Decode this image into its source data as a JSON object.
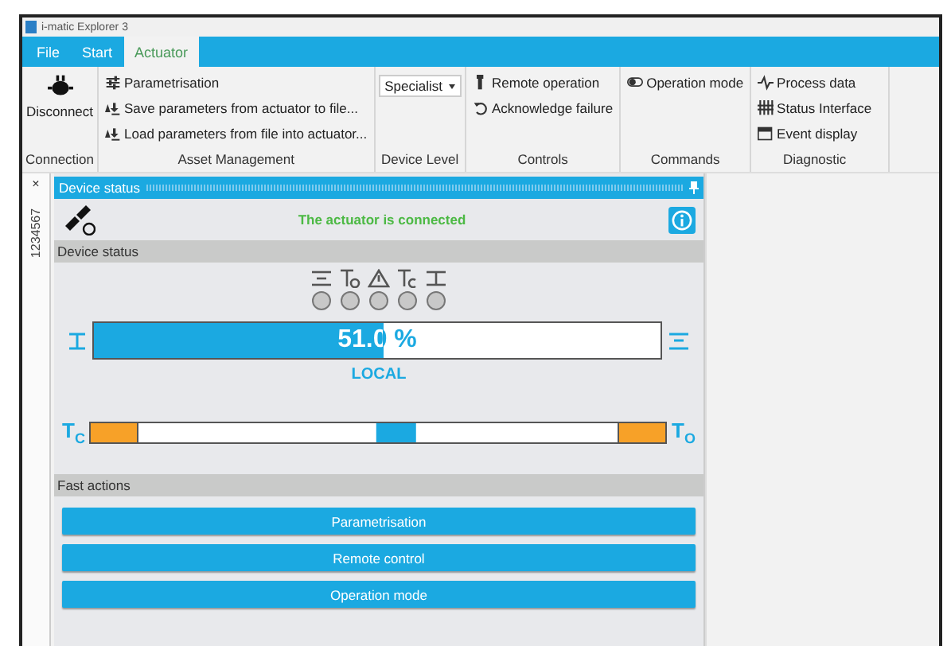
{
  "window": {
    "title": "i-matic Explorer 3"
  },
  "menu_tabs": [
    {
      "label": "File",
      "selected": false
    },
    {
      "label": "Start",
      "selected": false
    },
    {
      "label": "Actuator",
      "selected": true
    }
  ],
  "ribbon": {
    "groups": [
      {
        "title": "Connection",
        "items": [
          {
            "kind": "large",
            "label": "Disconnect"
          }
        ]
      },
      {
        "title": "Asset Management",
        "items": [
          {
            "kind": "small",
            "label": "Parametrisation"
          },
          {
            "kind": "small",
            "label": "Save parameters from actuator to file..."
          },
          {
            "kind": "small",
            "label": "Load parameters from file into actuator..."
          }
        ]
      },
      {
        "title": "Device Level",
        "items": [
          {
            "kind": "dropdown",
            "value": "Specialist"
          }
        ]
      },
      {
        "title": "Controls",
        "items": [
          {
            "kind": "small",
            "label": "Remote operation"
          },
          {
            "kind": "small",
            "label": "Acknowledge failure"
          }
        ]
      },
      {
        "title": "Commands",
        "items": [
          {
            "kind": "small",
            "label": "Operation mode"
          }
        ]
      },
      {
        "title": "Diagnostic",
        "items": [
          {
            "kind": "small",
            "label": "Process data"
          },
          {
            "kind": "small",
            "label": "Status Interface"
          },
          {
            "kind": "small",
            "label": "Event display"
          }
        ]
      }
    ]
  },
  "dock_tab": {
    "label": "1234567",
    "close": "×"
  },
  "panel": {
    "title": "Device status",
    "connection_message": "The actuator is connected",
    "status_section": {
      "title": "Device status",
      "indicators": [
        {
          "on": false
        },
        {
          "on": false
        },
        {
          "on": false
        },
        {
          "on": false
        },
        {
          "on": false
        }
      ],
      "position": {
        "level": 0.51,
        "reading": "51.0 %"
      },
      "mode": "LOCAL",
      "torque": {
        "left_label": "T$_{C}$",
        "right_label": "T$_{O}$",
        "level": 0.53
      }
    },
    "fast_actions": {
      "title": "Fast actions",
      "buttons": [
        "Parametrisation",
        "Remote control",
        "Operation mode"
      ]
    }
  }
}
